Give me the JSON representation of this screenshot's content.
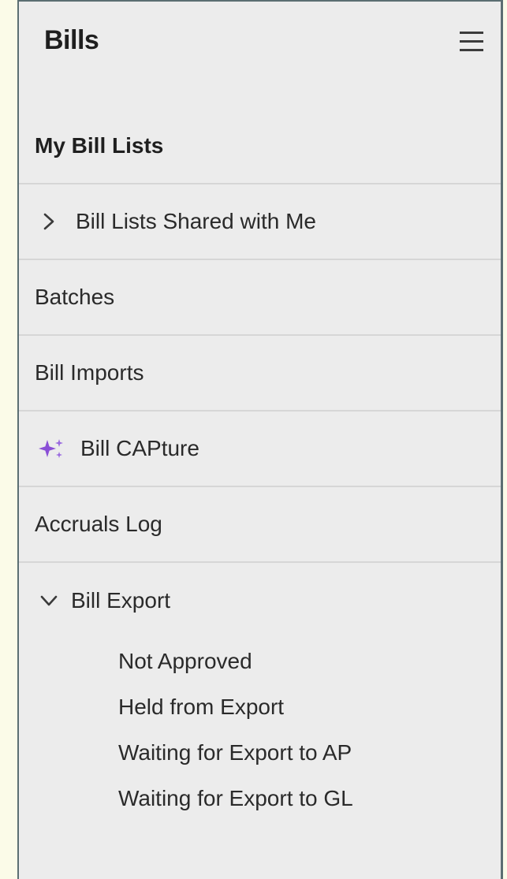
{
  "header": {
    "title": "Bills",
    "menu_icon": "hamburger-menu-icon"
  },
  "nav": {
    "my_bill_lists": "My Bill Lists",
    "shared_lists": "Bill Lists Shared with Me",
    "batches": "Batches",
    "bill_imports": "Bill Imports",
    "bill_capture": "Bill CAPture",
    "accruals_log": "Accruals Log",
    "bill_export": {
      "label": "Bill Export",
      "items": [
        "Not Approved",
        "Held from Export",
        "Waiting for Export to AP",
        "Waiting for Export to GL"
      ]
    }
  },
  "colors": {
    "page_background": "#fbfbe8",
    "panel_background": "#ececec",
    "border": "#5b6e72",
    "divider": "#d6d6d6",
    "sparkle_accent": "#8a4fd6"
  }
}
